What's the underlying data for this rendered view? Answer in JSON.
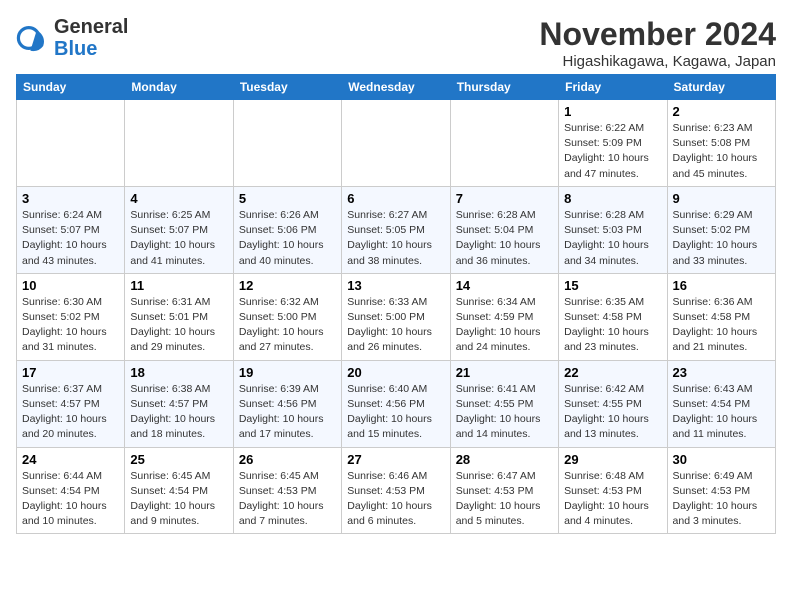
{
  "header": {
    "logo_general": "General",
    "logo_blue": "Blue",
    "month": "November 2024",
    "location": "Higashikagawa, Kagawa, Japan"
  },
  "weekdays": [
    "Sunday",
    "Monday",
    "Tuesday",
    "Wednesday",
    "Thursday",
    "Friday",
    "Saturday"
  ],
  "weeks": [
    [
      {
        "day": "",
        "info": ""
      },
      {
        "day": "",
        "info": ""
      },
      {
        "day": "",
        "info": ""
      },
      {
        "day": "",
        "info": ""
      },
      {
        "day": "",
        "info": ""
      },
      {
        "day": "1",
        "info": "Sunrise: 6:22 AM\nSunset: 5:09 PM\nDaylight: 10 hours and 47 minutes."
      },
      {
        "day": "2",
        "info": "Sunrise: 6:23 AM\nSunset: 5:08 PM\nDaylight: 10 hours and 45 minutes."
      }
    ],
    [
      {
        "day": "3",
        "info": "Sunrise: 6:24 AM\nSunset: 5:07 PM\nDaylight: 10 hours and 43 minutes."
      },
      {
        "day": "4",
        "info": "Sunrise: 6:25 AM\nSunset: 5:07 PM\nDaylight: 10 hours and 41 minutes."
      },
      {
        "day": "5",
        "info": "Sunrise: 6:26 AM\nSunset: 5:06 PM\nDaylight: 10 hours and 40 minutes."
      },
      {
        "day": "6",
        "info": "Sunrise: 6:27 AM\nSunset: 5:05 PM\nDaylight: 10 hours and 38 minutes."
      },
      {
        "day": "7",
        "info": "Sunrise: 6:28 AM\nSunset: 5:04 PM\nDaylight: 10 hours and 36 minutes."
      },
      {
        "day": "8",
        "info": "Sunrise: 6:28 AM\nSunset: 5:03 PM\nDaylight: 10 hours and 34 minutes."
      },
      {
        "day": "9",
        "info": "Sunrise: 6:29 AM\nSunset: 5:02 PM\nDaylight: 10 hours and 33 minutes."
      }
    ],
    [
      {
        "day": "10",
        "info": "Sunrise: 6:30 AM\nSunset: 5:02 PM\nDaylight: 10 hours and 31 minutes."
      },
      {
        "day": "11",
        "info": "Sunrise: 6:31 AM\nSunset: 5:01 PM\nDaylight: 10 hours and 29 minutes."
      },
      {
        "day": "12",
        "info": "Sunrise: 6:32 AM\nSunset: 5:00 PM\nDaylight: 10 hours and 27 minutes."
      },
      {
        "day": "13",
        "info": "Sunrise: 6:33 AM\nSunset: 5:00 PM\nDaylight: 10 hours and 26 minutes."
      },
      {
        "day": "14",
        "info": "Sunrise: 6:34 AM\nSunset: 4:59 PM\nDaylight: 10 hours and 24 minutes."
      },
      {
        "day": "15",
        "info": "Sunrise: 6:35 AM\nSunset: 4:58 PM\nDaylight: 10 hours and 23 minutes."
      },
      {
        "day": "16",
        "info": "Sunrise: 6:36 AM\nSunset: 4:58 PM\nDaylight: 10 hours and 21 minutes."
      }
    ],
    [
      {
        "day": "17",
        "info": "Sunrise: 6:37 AM\nSunset: 4:57 PM\nDaylight: 10 hours and 20 minutes."
      },
      {
        "day": "18",
        "info": "Sunrise: 6:38 AM\nSunset: 4:57 PM\nDaylight: 10 hours and 18 minutes."
      },
      {
        "day": "19",
        "info": "Sunrise: 6:39 AM\nSunset: 4:56 PM\nDaylight: 10 hours and 17 minutes."
      },
      {
        "day": "20",
        "info": "Sunrise: 6:40 AM\nSunset: 4:56 PM\nDaylight: 10 hours and 15 minutes."
      },
      {
        "day": "21",
        "info": "Sunrise: 6:41 AM\nSunset: 4:55 PM\nDaylight: 10 hours and 14 minutes."
      },
      {
        "day": "22",
        "info": "Sunrise: 6:42 AM\nSunset: 4:55 PM\nDaylight: 10 hours and 13 minutes."
      },
      {
        "day": "23",
        "info": "Sunrise: 6:43 AM\nSunset: 4:54 PM\nDaylight: 10 hours and 11 minutes."
      }
    ],
    [
      {
        "day": "24",
        "info": "Sunrise: 6:44 AM\nSunset: 4:54 PM\nDaylight: 10 hours and 10 minutes."
      },
      {
        "day": "25",
        "info": "Sunrise: 6:45 AM\nSunset: 4:54 PM\nDaylight: 10 hours and 9 minutes."
      },
      {
        "day": "26",
        "info": "Sunrise: 6:45 AM\nSunset: 4:53 PM\nDaylight: 10 hours and 7 minutes."
      },
      {
        "day": "27",
        "info": "Sunrise: 6:46 AM\nSunset: 4:53 PM\nDaylight: 10 hours and 6 minutes."
      },
      {
        "day": "28",
        "info": "Sunrise: 6:47 AM\nSunset: 4:53 PM\nDaylight: 10 hours and 5 minutes."
      },
      {
        "day": "29",
        "info": "Sunrise: 6:48 AM\nSunset: 4:53 PM\nDaylight: 10 hours and 4 minutes."
      },
      {
        "day": "30",
        "info": "Sunrise: 6:49 AM\nSunset: 4:53 PM\nDaylight: 10 hours and 3 minutes."
      }
    ]
  ]
}
